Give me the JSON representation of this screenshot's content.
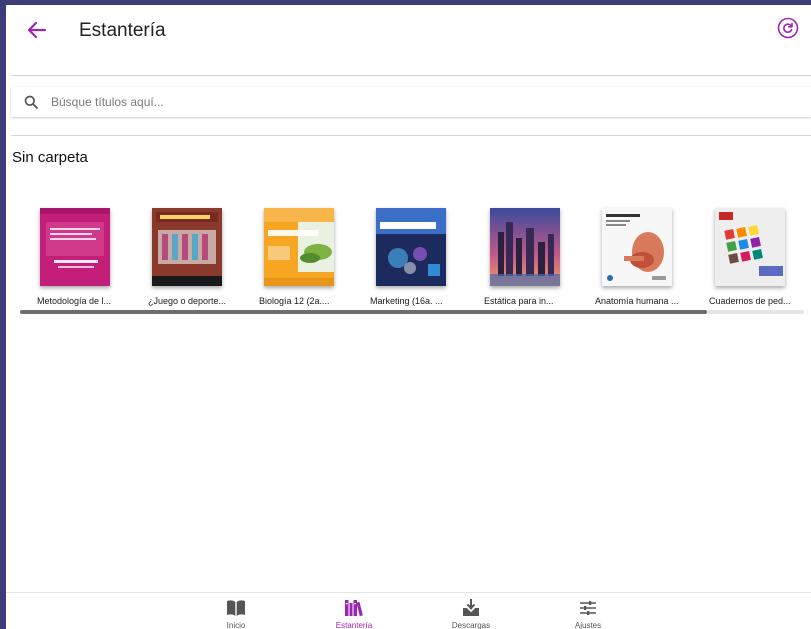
{
  "colors": {
    "accent": "#9c27b0",
    "background": "#3b3d78",
    "icon_default": "#555555"
  },
  "header": {
    "title": "Estantería",
    "back_icon": "arrow-left-icon",
    "refresh_icon": "refresh-icon"
  },
  "search": {
    "placeholder": "Búsque títulos aquí...",
    "value": "",
    "icon": "search-icon"
  },
  "section": {
    "title": "Sin carpeta"
  },
  "books": [
    {
      "title": "Metodología de l...",
      "cover_color": "#c21e7a"
    },
    {
      "title": "¿Juego o deporte...",
      "cover_color": "#8a3a2c"
    },
    {
      "title": "Biología 12 (2a....",
      "cover_color": "#f6a623"
    },
    {
      "title": "Marketing (16a. ...",
      "cover_color": "#1d2a5e"
    },
    {
      "title": "Estática para in...",
      "cover_color": "#5b3b8a"
    },
    {
      "title": "Anatomía humana ...",
      "cover_color": "#f2f2f2"
    },
    {
      "title": "Cuadernos de ped...",
      "cover_color": "#ececec"
    }
  ],
  "scrollbar": {
    "visible_fraction": 0.876
  },
  "bottom_nav": [
    {
      "label": "Inicio",
      "icon": "book-open-icon",
      "active": false
    },
    {
      "label": "Estantería",
      "icon": "bookshelf-icon",
      "active": true
    },
    {
      "label": "Descargas",
      "icon": "download-icon",
      "active": false
    },
    {
      "label": "Ajustes",
      "icon": "sliders-icon",
      "active": false
    }
  ]
}
